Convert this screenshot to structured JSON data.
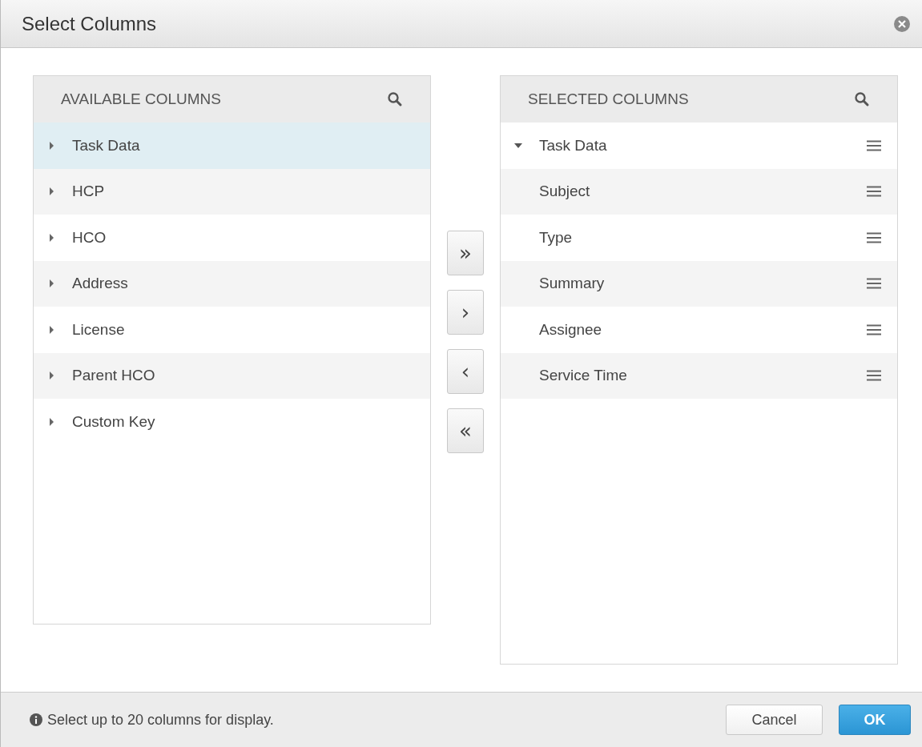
{
  "window": {
    "title": "Select Columns"
  },
  "available": {
    "header": "AVAILABLE COLUMNS",
    "items": [
      {
        "label": "Task Data",
        "expanded": false,
        "selected": true
      },
      {
        "label": "HCP",
        "expanded": false,
        "selected": false
      },
      {
        "label": "HCO",
        "expanded": false,
        "selected": false
      },
      {
        "label": "Address",
        "expanded": false,
        "selected": false
      },
      {
        "label": "License",
        "expanded": false,
        "selected": false
      },
      {
        "label": "Parent HCO",
        "expanded": false,
        "selected": false
      },
      {
        "label": "Custom Key",
        "expanded": false,
        "selected": false
      }
    ]
  },
  "transfer_buttons": [
    {
      "label": "»"
    },
    {
      "label": "›"
    },
    {
      "label": "‹"
    },
    {
      "label": "«"
    }
  ],
  "selected_columns": {
    "header": "SELECTED COLUMNS",
    "items": [
      {
        "label": "Task Data",
        "expanded": true,
        "children": [
          {
            "label": "Subject"
          },
          {
            "label": "Type"
          },
          {
            "label": "Summary"
          },
          {
            "label": "Assignee"
          },
          {
            "label": "Service Time"
          }
        ]
      }
    ]
  },
  "footer": {
    "info": "Select up to 20 columns for display.",
    "buttons": [
      {
        "label": "Cancel",
        "kind": "secondary"
      },
      {
        "label": "OK",
        "kind": "primary"
      }
    ]
  }
}
